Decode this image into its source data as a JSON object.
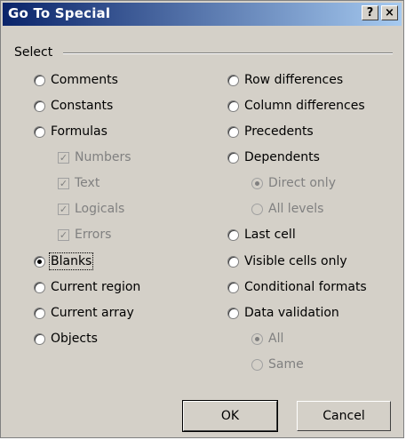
{
  "dialog": {
    "title": "Go To Special",
    "help_label": "?",
    "close_label": "×"
  },
  "group": {
    "label": "Select"
  },
  "left_options": [
    {
      "label": "Comments",
      "type": "radio",
      "checked": false,
      "enabled": true
    },
    {
      "label": "Constants",
      "type": "radio",
      "checked": false,
      "enabled": true
    },
    {
      "label": "Formulas",
      "type": "radio",
      "checked": false,
      "enabled": true
    },
    {
      "label": "Numbers",
      "type": "checkbox",
      "checked": true,
      "enabled": false
    },
    {
      "label": "Text",
      "type": "checkbox",
      "checked": true,
      "enabled": false
    },
    {
      "label": "Logicals",
      "type": "checkbox",
      "checked": true,
      "enabled": false
    },
    {
      "label": "Errors",
      "type": "checkbox",
      "checked": true,
      "enabled": false
    },
    {
      "label": "Blanks",
      "type": "radio",
      "checked": true,
      "enabled": true
    },
    {
      "label": "Current region",
      "type": "radio",
      "checked": false,
      "enabled": true
    },
    {
      "label": "Current array",
      "type": "radio",
      "checked": false,
      "enabled": true
    },
    {
      "label": "Objects",
      "type": "radio",
      "checked": false,
      "enabled": true
    }
  ],
  "right_options": [
    {
      "label": "Row differences",
      "type": "radio",
      "checked": false,
      "enabled": true
    },
    {
      "label": "Column differences",
      "type": "radio",
      "checked": false,
      "enabled": true
    },
    {
      "label": "Precedents",
      "type": "radio",
      "checked": false,
      "enabled": true
    },
    {
      "label": "Dependents",
      "type": "radio",
      "checked": false,
      "enabled": true
    },
    {
      "label": "Direct only",
      "type": "radio",
      "checked": true,
      "enabled": false
    },
    {
      "label": "All levels",
      "type": "radio",
      "checked": false,
      "enabled": false
    },
    {
      "label": "Last cell",
      "type": "radio",
      "checked": false,
      "enabled": true
    },
    {
      "label": "Visible cells only",
      "type": "radio",
      "checked": false,
      "enabled": true
    },
    {
      "label": "Conditional formats",
      "type": "radio",
      "checked": false,
      "enabled": true
    },
    {
      "label": "Data validation",
      "type": "radio",
      "checked": false,
      "enabled": true
    },
    {
      "label": "All",
      "type": "radio",
      "checked": true,
      "enabled": false
    },
    {
      "label": "Same",
      "type": "radio",
      "checked": false,
      "enabled": false
    }
  ],
  "buttons": {
    "ok": "OK",
    "cancel": "Cancel"
  },
  "colors": {
    "title_bar_start": "#0a246a",
    "title_bar_end": "#a6caf0",
    "face": "#d4d0c8"
  }
}
